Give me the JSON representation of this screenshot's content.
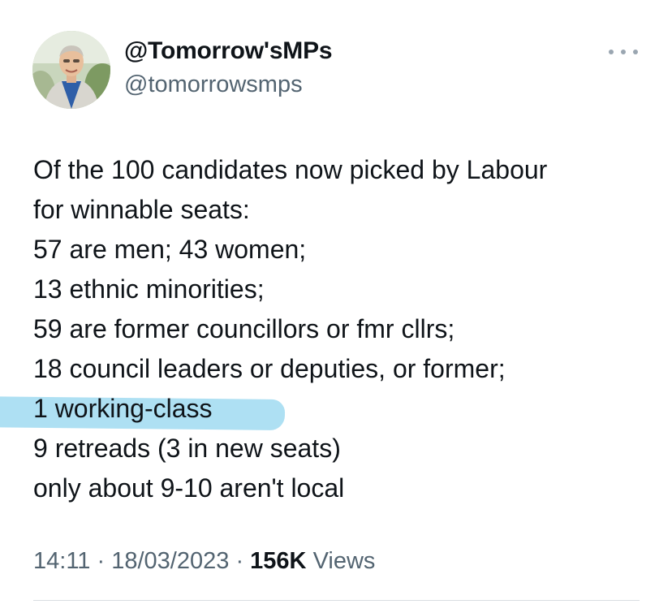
{
  "author": {
    "display_name": "@Tomorrow'sMPs",
    "handle": "@tomorrowsmps"
  },
  "tweet": {
    "lines": [
      "Of the 100 candidates now picked by Labour",
      "for winnable seats:",
      "57 are men; 43 women;",
      "13 ethnic minorities;",
      "59 are former councillors or fmr cllrs;",
      "18 council leaders or deputies, or former;",
      "1 working-class",
      "9 retreads (3 in new seats)",
      "only about 9-10 aren't local"
    ],
    "highlight_color": "#8fd4ef"
  },
  "meta": {
    "time": "14:11",
    "separator": "·",
    "date": "18/03/2023",
    "views_count": "156K",
    "views_label": "Views"
  },
  "icons": {
    "more": "more-horizontal-icon"
  },
  "colors": {
    "text": "#0f1419",
    "secondary": "#536471"
  }
}
